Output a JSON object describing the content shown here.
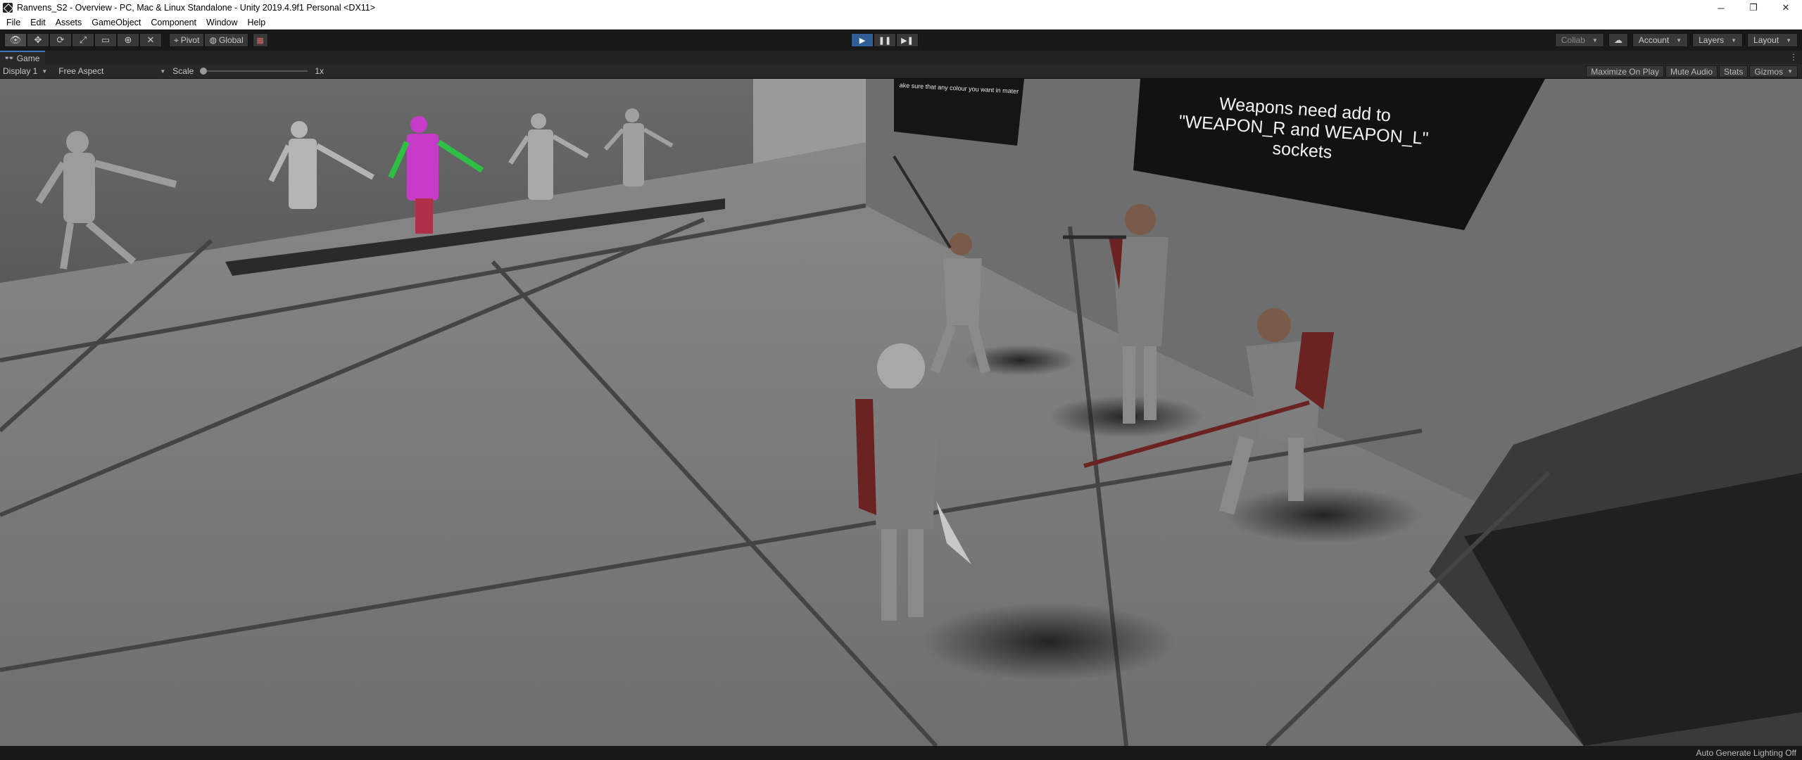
{
  "window": {
    "title": "Ranvens_S2 - Overview - PC, Mac & Linux Standalone - Unity 2019.4.9f1 Personal <DX11>",
    "controls": {
      "minimize": "─",
      "restore": "❐",
      "close": "✕"
    }
  },
  "menu": {
    "items": [
      "File",
      "Edit",
      "Assets",
      "GameObject",
      "Component",
      "Window",
      "Help"
    ]
  },
  "toolbar": {
    "tools": [
      {
        "icon": "hand-tool-icon",
        "glyph": "👁"
      },
      {
        "icon": "move-tool-icon",
        "glyph": "✥"
      },
      {
        "icon": "rotate-tool-icon",
        "glyph": "⟳"
      },
      {
        "icon": "scale-tool-icon",
        "glyph": "⤢"
      },
      {
        "icon": "rect-tool-icon",
        "glyph": "▭"
      },
      {
        "icon": "transform-tool-icon",
        "glyph": "⊕"
      },
      {
        "icon": "custom-tool-icon",
        "glyph": "✕"
      }
    ],
    "pivot_label": "Pivot",
    "global_label": "Global",
    "collab_label": "Collab",
    "account_label": "Account",
    "layers_label": "Layers",
    "layout_label": "Layout"
  },
  "playback": {
    "play": "▶",
    "pause": "❚❚",
    "step": "▶❚"
  },
  "game_tab": {
    "label": "Game",
    "display": "Display 1",
    "aspect": "Free Aspect",
    "scale_label": "Scale",
    "scale_value": "1x",
    "scale_level": 0,
    "buttons": [
      "Maximize On Play",
      "Mute Audio",
      "Stats",
      "Gizmos"
    ]
  },
  "scene": {
    "sign_main_line1": "Weapons need add to",
    "sign_main_line2": "\"WEAPON_R and WEAPON_L\" sockets",
    "sign_left_text": "ake sure that any colour you want in materials"
  },
  "status": {
    "text": "Auto Generate Lighting Off"
  },
  "colors": {
    "play_active": "#2f5d95",
    "tab_accent": "#3a79bb",
    "editor_bg": "#191919"
  }
}
